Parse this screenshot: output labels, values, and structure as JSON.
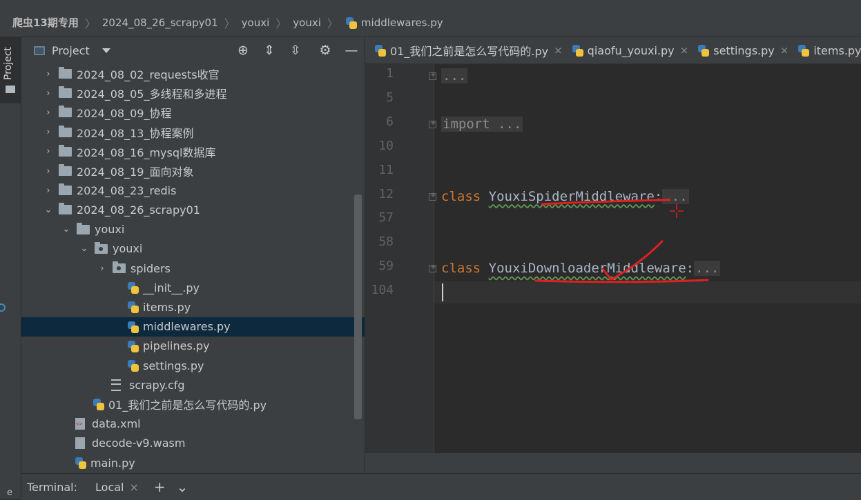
{
  "breadcrumb": {
    "items": [
      "爬虫13期专用",
      "2024_08_26_scrapy01",
      "youxi",
      "youxi",
      "middlewares.py"
    ]
  },
  "left_strip": {
    "project_tab": "Project",
    "bottom_letter": "e"
  },
  "project_panel": {
    "title": "Project",
    "icons": [
      "locate-icon",
      "expand-all-icon",
      "collapse-all-icon",
      "settings-icon",
      "minimize-icon"
    ],
    "tree": [
      {
        "label": "2024_08_02_requests收官",
        "kind": "folder",
        "arrow": "›"
      },
      {
        "label": "2024_08_05_多线程和多进程",
        "kind": "folder",
        "arrow": "›"
      },
      {
        "label": "2024_08_09_协程",
        "kind": "folder",
        "arrow": "›"
      },
      {
        "label": "2024_08_13_协程案例",
        "kind": "folder",
        "arrow": "›"
      },
      {
        "label": "2024_08_16_mysql数据库",
        "kind": "folder",
        "arrow": "›"
      },
      {
        "label": "2024_08_19_面向对象",
        "kind": "folder",
        "arrow": "›"
      },
      {
        "label": "2024_08_23_redis",
        "kind": "folder",
        "arrow": "›"
      },
      {
        "label": "2024_08_26_scrapy01",
        "kind": "folder",
        "arrow": "⌄"
      },
      {
        "label": "youxi",
        "kind": "folder",
        "arrow": "⌄"
      },
      {
        "label": "youxi",
        "kind": "package",
        "arrow": "⌄"
      },
      {
        "label": "spiders",
        "kind": "package",
        "arrow": "›"
      },
      {
        "label": "__init__.py",
        "kind": "py",
        "arrow": ""
      },
      {
        "label": "items.py",
        "kind": "py",
        "arrow": ""
      },
      {
        "label": "middlewares.py",
        "kind": "py",
        "arrow": "",
        "selected": true
      },
      {
        "label": "pipelines.py",
        "kind": "py",
        "arrow": ""
      },
      {
        "label": "settings.py",
        "kind": "py",
        "arrow": ""
      },
      {
        "label": "scrapy.cfg",
        "kind": "cfg",
        "arrow": ""
      },
      {
        "label": "01_我们之前是怎么写代码的.py",
        "kind": "py",
        "arrow": ""
      },
      {
        "label": "data.xml",
        "kind": "xml",
        "arrow": ""
      },
      {
        "label": "decode-v9.wasm",
        "kind": "file",
        "arrow": ""
      },
      {
        "label": "main.py",
        "kind": "py",
        "arrow": ""
      }
    ]
  },
  "tabs": [
    {
      "label": "01_我们之前是怎么写代码的.py"
    },
    {
      "label": "qiaofu_youxi.py"
    },
    {
      "label": "settings.py"
    },
    {
      "label": "items.py"
    }
  ],
  "editor": {
    "line_numbers": [
      "1",
      "5",
      "6",
      "10",
      "11",
      "12",
      "57",
      "58",
      "59",
      "104"
    ],
    "lines": [
      {
        "text": "...",
        "type": "folded"
      },
      {
        "text": "",
        "type": "blank"
      },
      {
        "text": "import ...",
        "type": "import"
      },
      {
        "text": "",
        "type": "blank"
      },
      {
        "text": "",
        "type": "blank"
      },
      {
        "kw": "class",
        "name": "YouxiSpiderMiddleware",
        "tail": ":",
        "folded": "...",
        "type": "class"
      },
      {
        "text": "",
        "type": "blank"
      },
      {
        "text": "",
        "type": "blank"
      },
      {
        "kw": "class",
        "name": "YouxiDownloaderMiddleware",
        "tail": ":",
        "folded": "...",
        "type": "class"
      },
      {
        "text": "",
        "type": "blank"
      }
    ]
  },
  "terminal": {
    "label": "Terminal:",
    "tab": "Local",
    "close": "×",
    "add": "+",
    "more": "⌄"
  },
  "colors": {
    "keyword": "#cc7832",
    "annotation": "#e02020",
    "selection": "#0d293e"
  }
}
